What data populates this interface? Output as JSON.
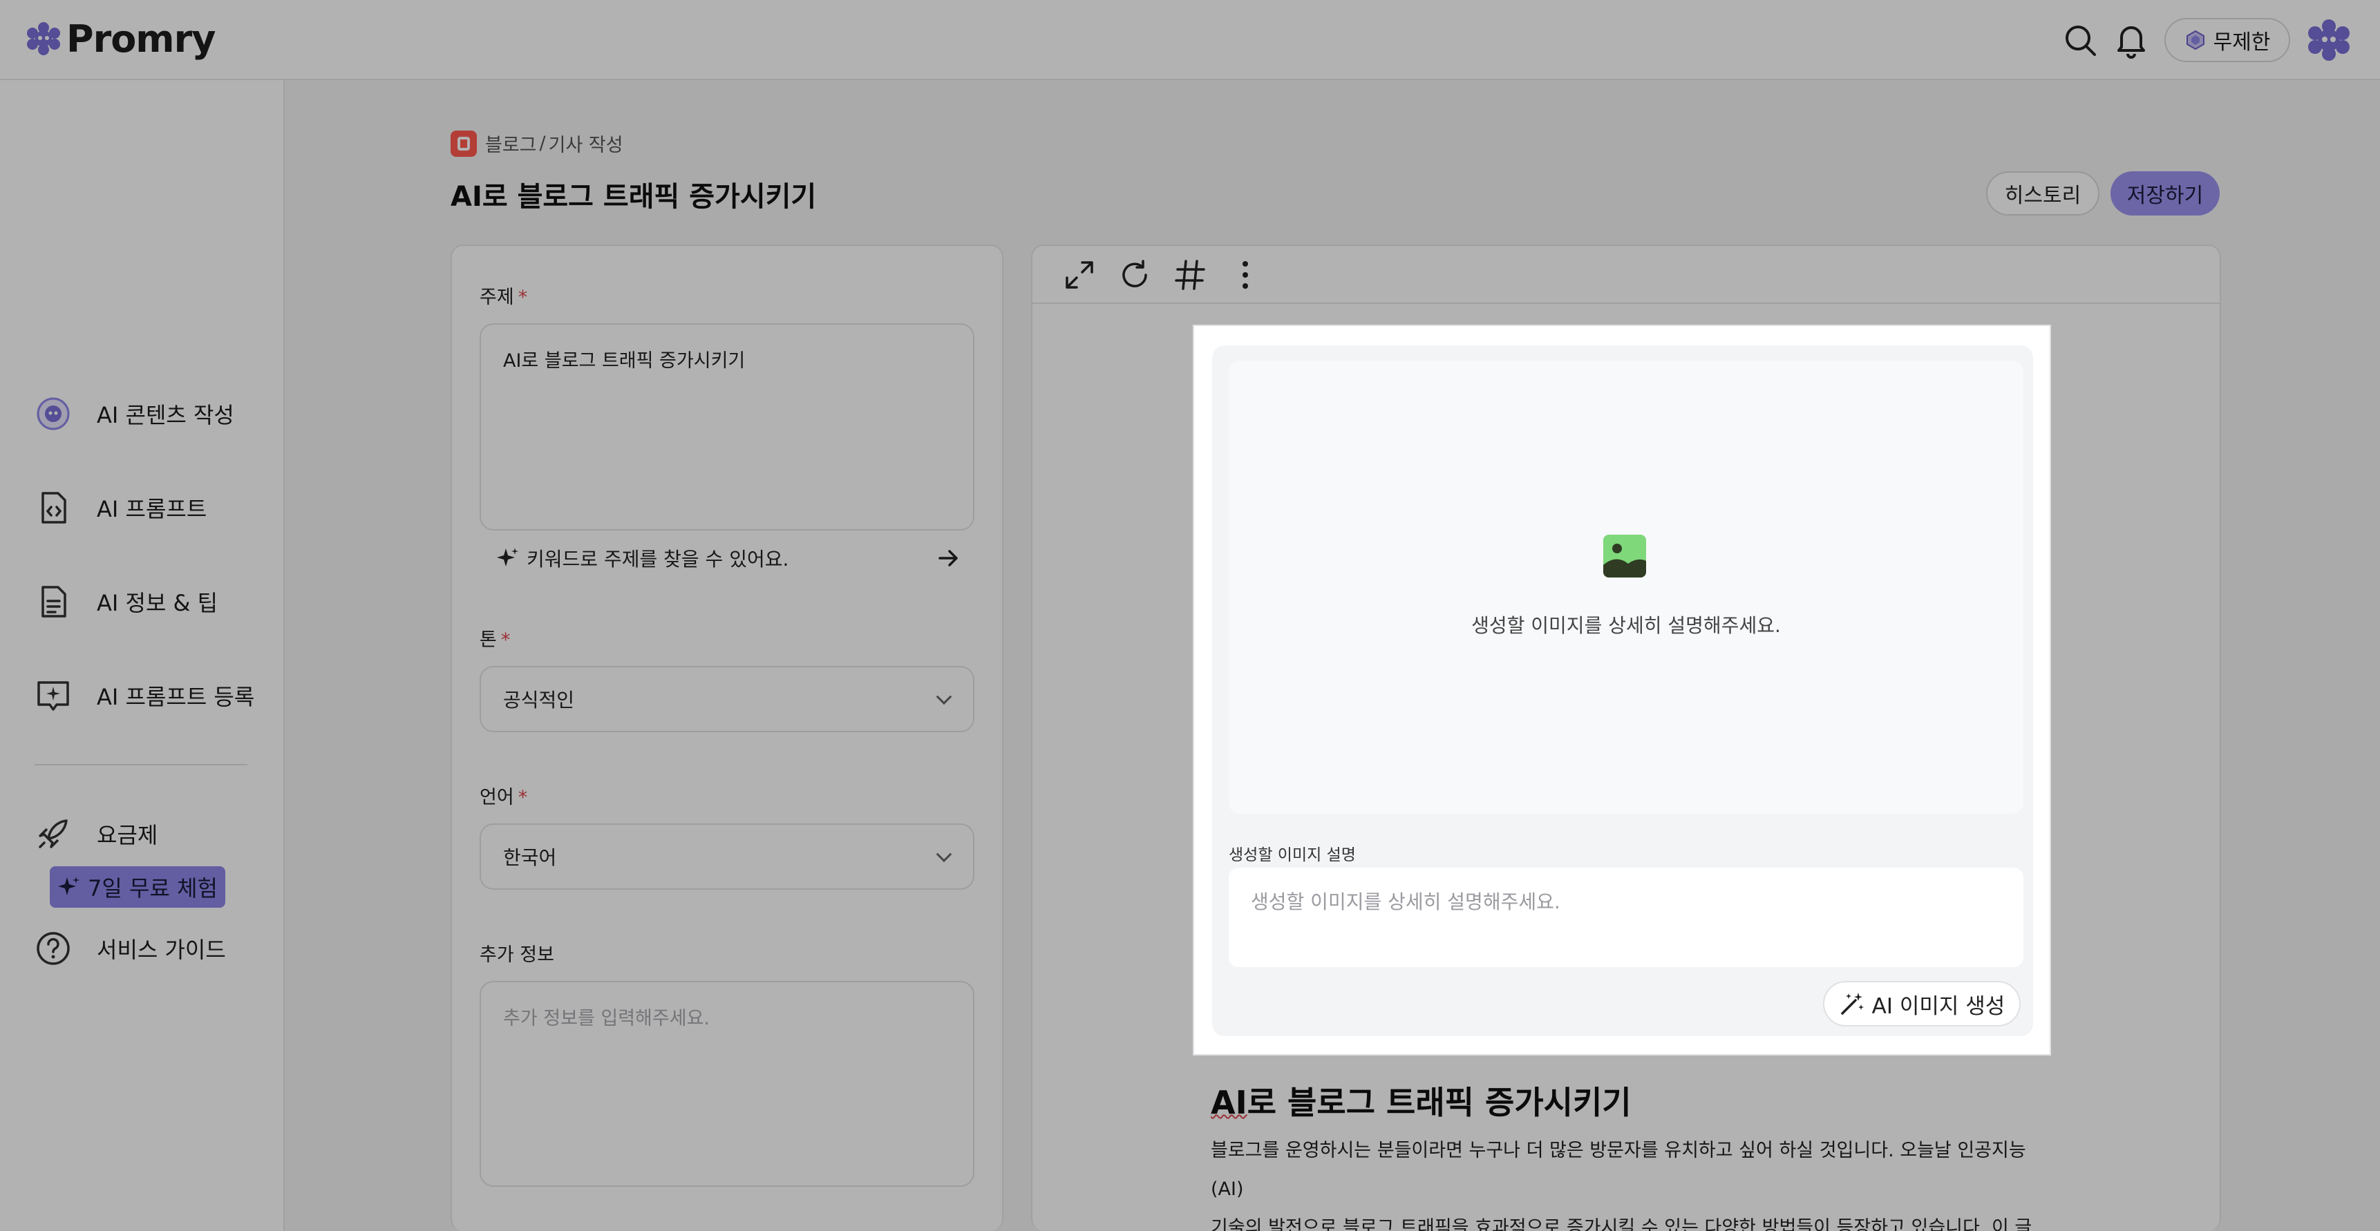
{
  "header": {
    "logo_text": "Promry",
    "plan_label": "무제한"
  },
  "sidebar": {
    "items": [
      {
        "label": "AI 콘텐츠 작성",
        "icon": "ai-content-icon"
      },
      {
        "label": "AI 프롬프트",
        "icon": "code-file-icon"
      },
      {
        "label": "AI 정보 & 팁",
        "icon": "document-icon"
      },
      {
        "label": "AI 프롬프트 등록",
        "icon": "chat-sparkle-icon"
      },
      {
        "label": "요금제",
        "icon": "rocket-icon"
      },
      {
        "label": "서비스 가이드",
        "icon": "help-icon"
      }
    ],
    "trial_badge": "7일 무료 체험"
  },
  "breadcrumb": {
    "category": "블로그",
    "separator": "/",
    "page": "기사 작성"
  },
  "page": {
    "title": "AI로 블로그 트래픽 증가시키기",
    "history_button": "히스토리",
    "save_button": "저장하기"
  },
  "form": {
    "topic": {
      "label": "주제",
      "required_mark": "*",
      "value": "AI로 블로그 트래픽 증가시키기"
    },
    "keyword_hint": "키워드로 주제를 찾을 수 있어요.",
    "tone": {
      "label": "톤",
      "required_mark": "*",
      "value": "공식적인"
    },
    "language": {
      "label": "언어",
      "required_mark": "*",
      "value": "한국어"
    },
    "extra_info": {
      "label": "추가 정보",
      "placeholder": "추가 정보를 입력해주세요."
    }
  },
  "editor": {
    "toolbar": [
      "expand-icon",
      "refresh-icon",
      "hashtag-icon",
      "more-vertical-icon"
    ],
    "image_block": {
      "drop_text": "생성할 이미지를 상세히 설명해주세요.",
      "desc_label": "생성할 이미지 설명",
      "desc_placeholder": "생성할 이미지를 상세히 설명해주세요.",
      "generate_button": "AI 이미지 생성"
    },
    "doc_title_prefix": "AI",
    "doc_title_rest": "로 블로그 트래픽 증가시키기",
    "doc_lines": [
      "블로그를 운영하시는 분들이라면 누구나 더 많은 방문자를 유치하고 싶어 하실 것입니다. 오늘날 인공지능(AI)",
      "기술의 발전으로 블로그 트래픽을 효과적으로 증가시킬 수 있는 다양한 방법들이 등장하고 있습니다. 이 글에서"
    ]
  },
  "colors": {
    "accent": "#9b92f0",
    "required": "#e0474c",
    "overlay": "rgba(0,0,0,0.30)"
  }
}
